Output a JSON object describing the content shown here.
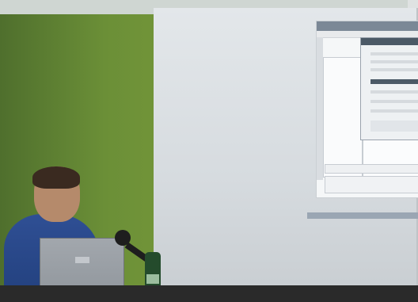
{
  "scene": {
    "description_items": [],
    "colors": {
      "wall": "#6b8f37",
      "screen": "#dfe3e6",
      "shirt": "#22407d",
      "laptop": "#9ba1a7",
      "bottle": "#244b2c"
    }
  }
}
